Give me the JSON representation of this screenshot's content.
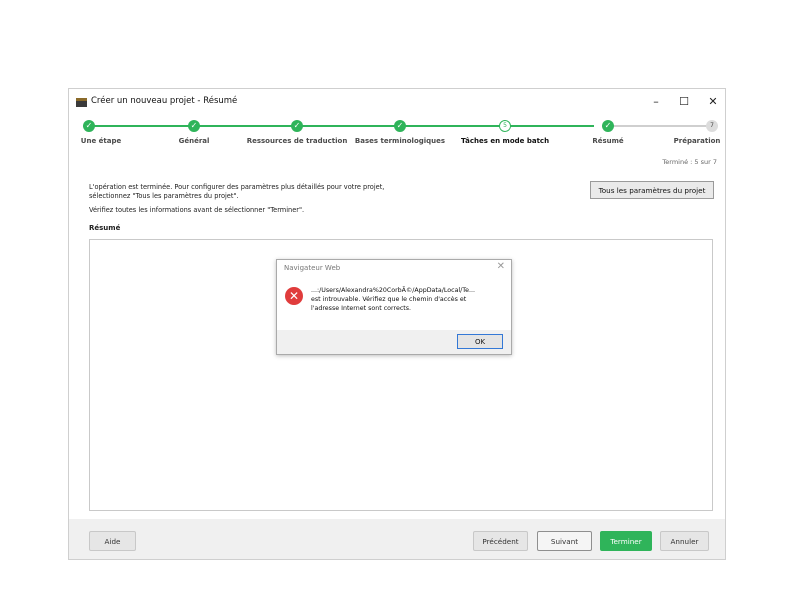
{
  "window": {
    "title": "Créer un nouveau projet - Résumé",
    "controls": {
      "minimize": "–",
      "maximize": "☐",
      "close": "✕"
    }
  },
  "wizard": {
    "steps": [
      {
        "label": "Une étape",
        "state": "done",
        "marker": "✓"
      },
      {
        "label": "Général",
        "state": "done",
        "marker": "✓"
      },
      {
        "label": "Ressources de traduction",
        "state": "done",
        "marker": "✓"
      },
      {
        "label": "Bases terminologiques",
        "state": "done",
        "marker": "✓"
      },
      {
        "label": "Tâches en mode batch",
        "state": "current",
        "marker": "5"
      },
      {
        "label": "Résumé",
        "state": "done",
        "marker": "✓"
      },
      {
        "label": "Préparation",
        "state": "pending",
        "marker": "7"
      }
    ],
    "progress": "Terminé : 5 sur 7"
  },
  "content": {
    "info_line1": "L'opération est terminée. Pour configurer des paramètres plus détaillés pour votre projet,",
    "info_line2": "sélectionnez \"Tous les paramètres du projet\".",
    "info_line3": "Vérifiez toutes les informations avant de sélectionner \"Terminer\".",
    "params_button": "Tous les paramètres du projet",
    "summary_label": "Résumé"
  },
  "dialog": {
    "title": "Navigateur Web",
    "close": "✕",
    "icon": "✕",
    "message_line1": "...:/Users/Alexandra%20CorbÃ©/AppData/Local/Te...",
    "message_line2": "est introuvable. Vérifiez que le chemin d'accès et",
    "message_line3": "l'adresse Internet sont corrects.",
    "ok": "OK"
  },
  "footer": {
    "help": "Aide",
    "previous": "Précédent",
    "next": "Suivant",
    "finish": "Terminer",
    "cancel": "Annuler"
  },
  "colors": {
    "accent_green": "#2fb45a",
    "error_red": "#e03c3c",
    "ok_button_border": "#3378d6"
  }
}
